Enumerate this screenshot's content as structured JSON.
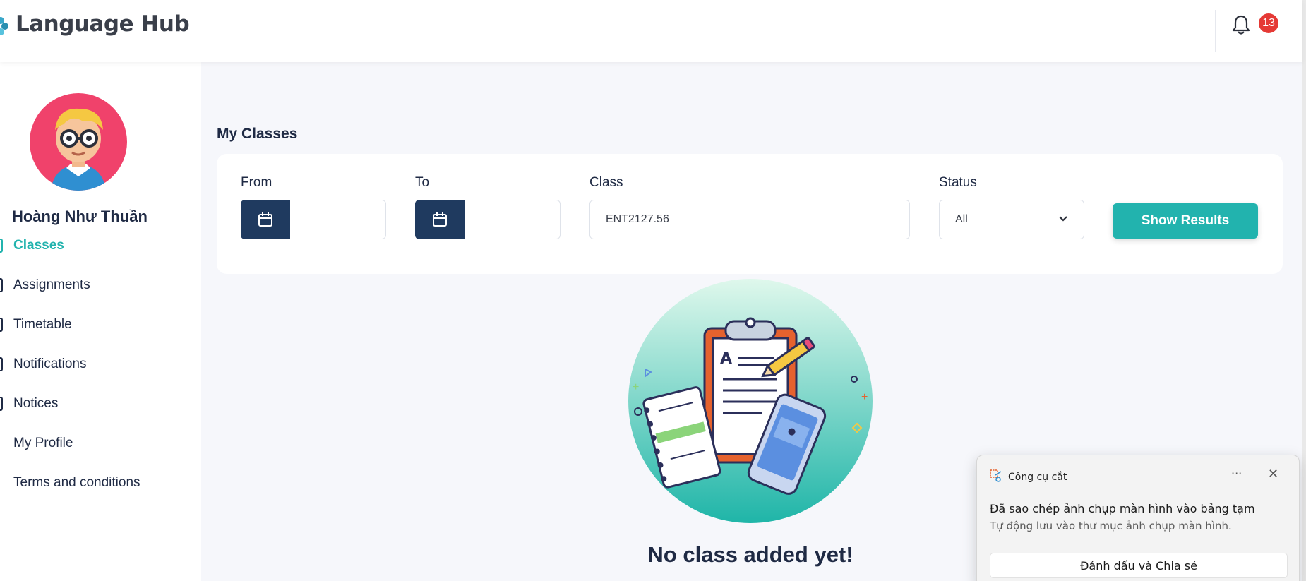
{
  "header": {
    "brand": "Language Hub",
    "notification_count": "13"
  },
  "sidebar": {
    "user_name": "Hoàng Như Thuần",
    "items": [
      {
        "label": "Classes",
        "active": true
      },
      {
        "label": "Assignments"
      },
      {
        "label": "Timetable"
      },
      {
        "label": "Notifications"
      },
      {
        "label": "Notices"
      },
      {
        "label": "My Profile"
      },
      {
        "label": "Terms and conditions"
      }
    ]
  },
  "main": {
    "title": "My Classes",
    "filters": {
      "from_label": "From",
      "to_label": "To",
      "class_label": "Class",
      "class_value": "ENT2127.56",
      "status_label": "Status",
      "status_value": "All",
      "show_results_label": "Show Results"
    },
    "empty": {
      "title": "No class added yet!"
    }
  },
  "toast": {
    "app_name": "Công cụ cắt",
    "more": "···",
    "title": "Đã sao chép ảnh chụp màn hình vào bảng tạm",
    "subtitle": "Tự động lưu vào thư mục ảnh chụp màn hình.",
    "action_label": "Đánh dấu và Chia sẻ"
  },
  "colors": {
    "accent": "#22b3ae",
    "navy": "#1f3a5f",
    "badge": "#e53935",
    "avatar_bg": "#f0426b"
  }
}
